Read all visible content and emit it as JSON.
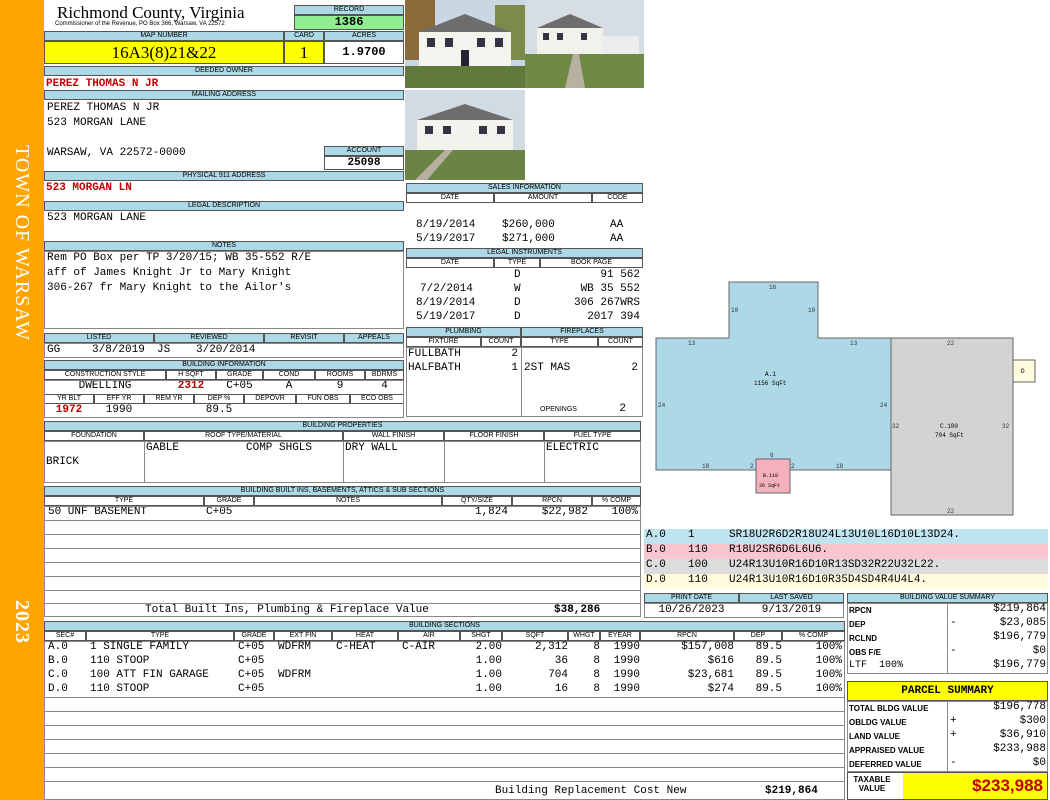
{
  "header": {
    "county": "Richmond County, Virginia",
    "sub": "Commissioner of the Revenue, PO Box 366, Warsaw, VA 22572",
    "record_label": "RECORD",
    "record": "1386",
    "map_label": "MAP NUMBER",
    "map": "16A3(8)21&22",
    "card_label": "CARD",
    "card": "1",
    "acres_label": "ACRES",
    "acres": "1.9700"
  },
  "sidebar": {
    "town": "TOWN OF WARSAW",
    "year": "2023"
  },
  "owner": {
    "label": "DEEDED OWNER",
    "name": "PEREZ THOMAS N JR",
    "mail_label": "MAILING ADDRESS",
    "mail1": "PEREZ THOMAS N JR",
    "mail2": "523 MORGAN LANE",
    "mail3": "WARSAW, VA 22572-0000",
    "account_label": "ACCOUNT",
    "account": "25098",
    "phys_label": "PHYSICAL 911 ADDRESS",
    "phys": "523 MORGAN LN",
    "legal_label": "LEGAL DESCRIPTION",
    "legal": "523 MORGAN LANE",
    "notes_label": "NOTES",
    "notes": [
      "Rem PO Box per TP 3/20/15; WB 35-552 R/E",
      "aff of James Knight Jr to Mary Knight",
      "306-267 fr Mary Knight to the Ailor's"
    ]
  },
  "sales": {
    "label": "SALES INFORMATION",
    "h": [
      "DATE",
      "AMOUNT",
      "CODE"
    ],
    "rows": [
      [
        "8/19/2014",
        "$260,000",
        "AA"
      ],
      [
        "5/19/2017",
        "$271,000",
        "AA"
      ]
    ]
  },
  "legal_inst": {
    "label": "LEGAL INSTRUMENTS",
    "h": [
      "DATE",
      "TYPE",
      "BOOK PAGE"
    ],
    "rows": [
      [
        "",
        "D",
        "91 562"
      ],
      [
        "7/2/2014",
        "W",
        "WB 35 552"
      ],
      [
        "8/19/2014",
        "D",
        "306 267WRS"
      ],
      [
        "5/19/2017",
        "D",
        "2017 394"
      ]
    ]
  },
  "plumbing": {
    "label": "PLUMBING",
    "h": [
      "FIXTURE",
      "COUNT"
    ],
    "rows": [
      [
        "FULLBATH",
        "2"
      ],
      [
        "HALFBATH",
        "1"
      ]
    ]
  },
  "fireplaces": {
    "label": "FIREPLACES",
    "h": [
      "TYPE",
      "COUNT"
    ],
    "rows": [
      [
        "2ST MAS",
        "2"
      ]
    ],
    "openings_label": "OPENINGS",
    "openings": "2"
  },
  "listed": {
    "h": [
      "LISTED",
      "REVIEWED",
      "REVISIT",
      "APPEALS"
    ],
    "listed_by": "GG",
    "listed_date": "3/8/2019",
    "reviewed_by": "JS",
    "reviewed_date": "3/20/2014"
  },
  "bldg_info": {
    "label": "BUILDING INFORMATION",
    "h": [
      "CONSTRUCTION STYLE",
      "H SQFT",
      "GRADE",
      "COND",
      "ROOMS",
      "BDRMS"
    ],
    "v": [
      "DWELLING",
      "2312",
      "C+05",
      "A",
      "9",
      "4"
    ],
    "h2": [
      "YR BLT",
      "EFF YR",
      "REM YR",
      "DEP %",
      "DEPOVR",
      "FUN OBS",
      "ECO OBS"
    ],
    "v2": [
      "1972",
      "1990",
      "",
      "89.5",
      "",
      "",
      ""
    ]
  },
  "props": {
    "label": "BUILDING PROPERTIES",
    "h": [
      "FOUNDATION",
      "ROOF TYPE/MATERIAL",
      "WALL FINISH",
      "FLOOR FINISH",
      "FUEL TYPE"
    ],
    "foundation": "BRICK",
    "roof1": "GABLE",
    "roof2": "COMP SHGLS",
    "wall": "DRY WALL",
    "fuel": "ELECTRIC"
  },
  "builtins": {
    "label": "BUILDING BUILT INS, BASEMENTS, ATTICS & SUB SECTIONS",
    "h": [
      "TYPE",
      "GRADE",
      "NOTES",
      "QTY/SIZE",
      "RPCN",
      "% COMP"
    ],
    "rows": [
      [
        "50 UNF BASEMENT",
        "C+05",
        "",
        "1,824",
        "$22,982",
        "100%"
      ]
    ],
    "total_label": "Total Built Ins, Plumbing & Fireplace Value",
    "total": "$38,286"
  },
  "dates": {
    "h": [
      "PRINT DATE",
      "LAST SAVED"
    ],
    "print": "10/26/2023",
    "saved": "9/13/2019"
  },
  "sketch": {
    "a_label": "A.1",
    "a_area": "1156 SqFt",
    "c_label": "C.100",
    "c_area": "704 SqFt",
    "b_label": "B.110",
    "b_area": "36 SqFt",
    "d_label": "D",
    "dims": [
      "16",
      "10",
      "10",
      "13",
      "13",
      "24",
      "24",
      "18",
      "2",
      "6",
      "2",
      "18",
      "22",
      "32",
      "32",
      "22"
    ]
  },
  "vectors": [
    {
      "code": "A.0",
      "num": "1",
      "v": "SR18U2R6D2R18U24L13U10L16D10L13D24.",
      "color": "#bfe3ef"
    },
    {
      "code": "B.0",
      "num": "110",
      "v": "R18U2SR6D6L6U6.",
      "color": "#f7c6ce"
    },
    {
      "code": "C.0",
      "num": "100",
      "v": "U24R13U10R16D10R13SD32R22U32L22.",
      "color": "#dcdcdc"
    },
    {
      "code": "D.0",
      "num": "110",
      "v": "U24R13U10R16D10R35D4SD4R4U4L4.",
      "color": "#fffbdc"
    }
  ],
  "sections": {
    "label": "BUILDING SECTIONS",
    "h": [
      "SEC#",
      "TYPE",
      "GRADE",
      "EXT FIN",
      "HEAT",
      "AIR",
      "SHGT",
      "SQFT",
      "WHGT",
      "EYEAR",
      "RPCN",
      "DEP",
      "% COMP"
    ],
    "rows": [
      [
        "A.0",
        "1 SINGLE FAMILY",
        "C+05",
        "WDFRM",
        "C-HEAT",
        "C-AIR",
        "2.00",
        "2,312",
        "8",
        "1990",
        "$157,008",
        "89.5",
        "100%"
      ],
      [
        "B.0",
        "110 STOOP",
        "C+05",
        "",
        "",
        "",
        "1.00",
        "36",
        "8",
        "1990",
        "$616",
        "89.5",
        "100%"
      ],
      [
        "C.0",
        "100 ATT FIN GARAGE",
        "C+05",
        "WDFRM",
        "",
        "",
        "1.00",
        "704",
        "8",
        "1990",
        "$23,681",
        "89.5",
        "100%"
      ],
      [
        "D.0",
        "110 STOOP",
        "C+05",
        "",
        "",
        "",
        "1.00",
        "16",
        "8",
        "1990",
        "$274",
        "89.5",
        "100%"
      ]
    ],
    "total_label": "Building Replacement Cost New",
    "total": "$219,864"
  },
  "bvs": {
    "label": "BUILDING VALUE SUMMARY",
    "rows": [
      [
        "RPCN",
        "",
        "$219,864"
      ],
      [
        "DEP",
        "-",
        "$23,085"
      ],
      [
        "RCLND",
        "",
        "$196,779"
      ],
      [
        "OBS F/E",
        "-",
        "$0"
      ],
      [
        "LTF  100%",
        "",
        "$196,779"
      ]
    ]
  },
  "parcel": {
    "label": "PARCEL SUMMARY",
    "rows": [
      [
        "TOTAL BLDG VALUE",
        "",
        "$196,778"
      ],
      [
        "OBLDG VALUE",
        "+",
        "$300"
      ],
      [
        "LAND VALUE",
        "+",
        "$36,910"
      ],
      [
        "APPRAISED VALUE",
        "",
        "$233,988"
      ],
      [
        "DEFERRED VALUE",
        "-",
        "$0"
      ]
    ],
    "taxable_label": "TAXABLE VALUE",
    "taxable": "$233,988"
  }
}
